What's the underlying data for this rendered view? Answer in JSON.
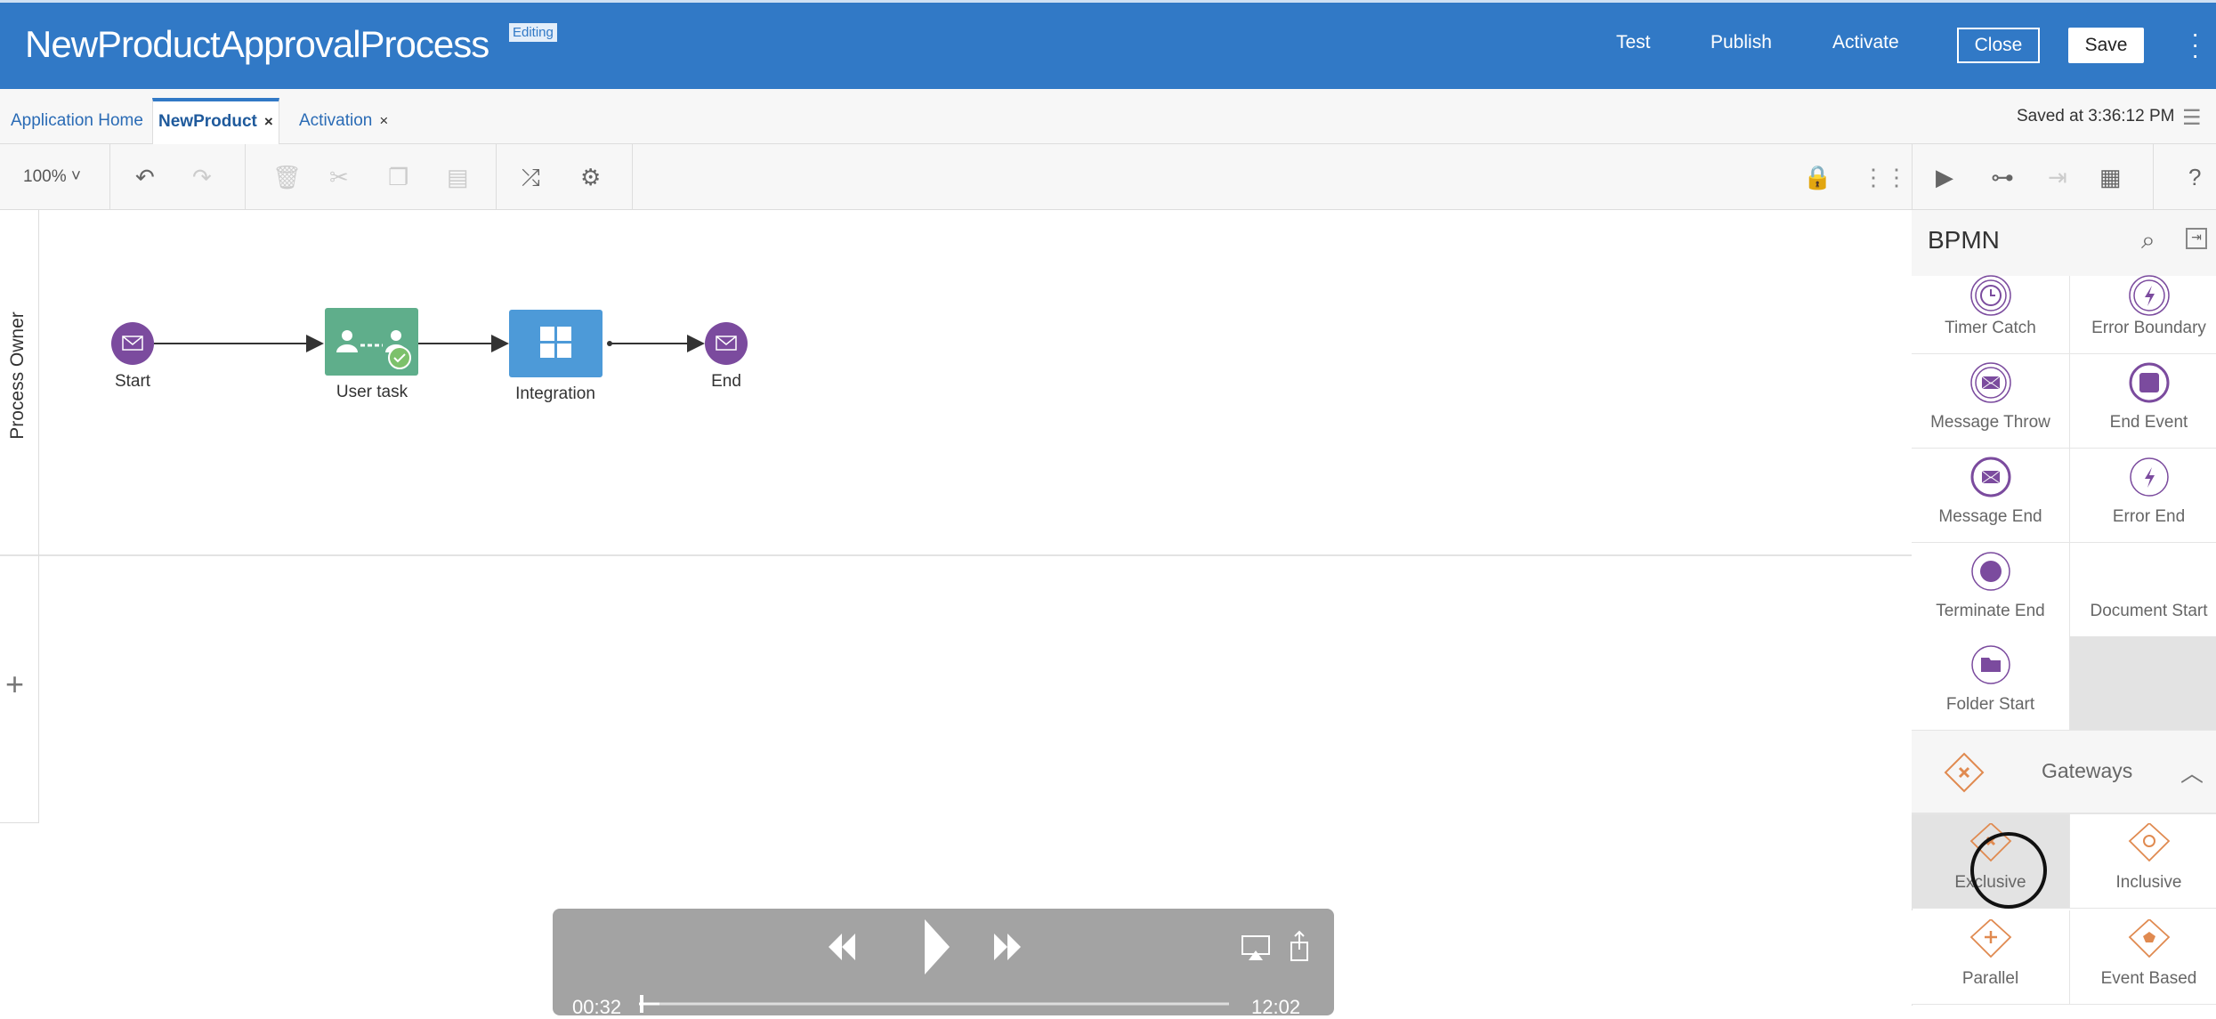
{
  "header": {
    "title": "NewProductApprovalProcess",
    "badge": "Editing",
    "actions": [
      "Test",
      "Publish",
      "Activate"
    ],
    "close": "Close",
    "save": "Save"
  },
  "tabs": [
    {
      "label": "Application Home"
    },
    {
      "label": "NewProduct",
      "active": true,
      "close": "×"
    },
    {
      "label": "Activation",
      "close": "×"
    }
  ],
  "status": {
    "saved": "Saved at 3:36:12 PM"
  },
  "toolbar": {
    "zoom": "100%"
  },
  "lanes": [
    {
      "label": "Process Owner"
    }
  ],
  "diagram": {
    "nodes": [
      {
        "type": "start-message",
        "label": "Start"
      },
      {
        "type": "user-task",
        "label": "User task"
      },
      {
        "type": "integration",
        "label": "Integration"
      },
      {
        "type": "end-message",
        "label": "End"
      }
    ],
    "colors": {
      "event": "#7b4b9e",
      "user_task": "#5fae8b",
      "integration": "#4d9ad8"
    }
  },
  "palette": {
    "title": "BPMN",
    "events": [
      "Timer Catch",
      "Error Boundary",
      "Message Throw",
      "End Event",
      "Message End",
      "Error End",
      "Terminate End",
      "Document Start",
      "Folder Start"
    ],
    "gateways_title": "Gateways",
    "gateways": [
      "Exclusive",
      "Inclusive",
      "Parallel",
      "Event Based"
    ],
    "colors": {
      "event": "#7b4b9e",
      "gateway": "#e08a50"
    }
  },
  "video": {
    "elapsed": "00:32",
    "remaining": "12:02"
  }
}
